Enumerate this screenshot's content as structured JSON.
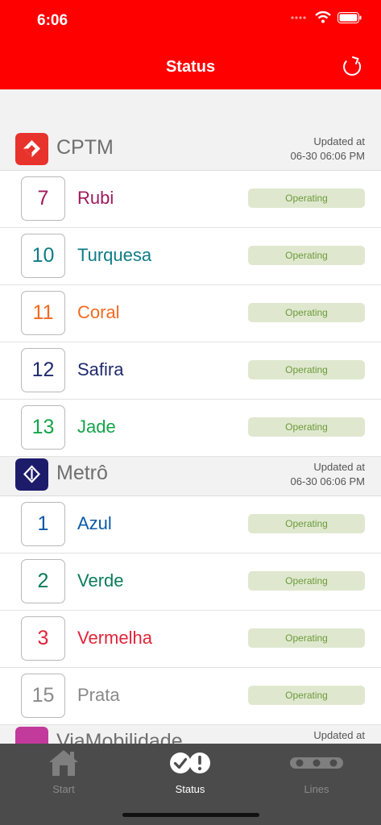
{
  "statusbar": {
    "time": "6:06"
  },
  "header": {
    "title": "Status"
  },
  "colors": {
    "accent": "#ff0000",
    "badge_bg": "#dfe8cf",
    "badge_text": "#6c9a3a",
    "tabbar": "#4b4b4b"
  },
  "sections": [
    {
      "name": "CPTM",
      "updated_label": "Updated at",
      "updated_time": "06-30 06:06 PM",
      "logo_color": "#e8322c",
      "lines": [
        {
          "number": "7",
          "name": "Rubi",
          "color": "#a0185c",
          "status": "Operating"
        },
        {
          "number": "10",
          "name": "Turquesa",
          "color": "#0e7c86",
          "status": "Operating"
        },
        {
          "number": "11",
          "name": "Coral",
          "color": "#f26a21",
          "status": "Operating"
        },
        {
          "number": "12",
          "name": "Safira",
          "color": "#1f2a6b",
          "status": "Operating"
        },
        {
          "number": "13",
          "name": "Jade",
          "color": "#14a54a",
          "status": "Operating"
        }
      ]
    },
    {
      "name": "Metrô",
      "updated_label": "Updated at",
      "updated_time": "06-30 06:06 PM",
      "logo_color": "#1d1c6b",
      "lines": [
        {
          "number": "1",
          "name": "Azul",
          "color": "#0a5aa8",
          "status": "Operating"
        },
        {
          "number": "2",
          "name": "Verde",
          "color": "#0a7b5c",
          "status": "Operating"
        },
        {
          "number": "3",
          "name": "Vermelha",
          "color": "#e0243a",
          "status": "Operating"
        },
        {
          "number": "15",
          "name": "Prata",
          "color": "#8a8a8a",
          "status": "Operating"
        }
      ]
    },
    {
      "name": "ViaMobilidade",
      "updated_label": "Updated at",
      "logo_color": "#c23a9c",
      "lines": []
    }
  ],
  "tabs": [
    {
      "label": "Start",
      "icon": "house-icon",
      "active": false
    },
    {
      "label": "Status",
      "icon": "status-check-icon",
      "active": true
    },
    {
      "label": "Lines",
      "icon": "lines-dots-icon",
      "active": false
    }
  ]
}
